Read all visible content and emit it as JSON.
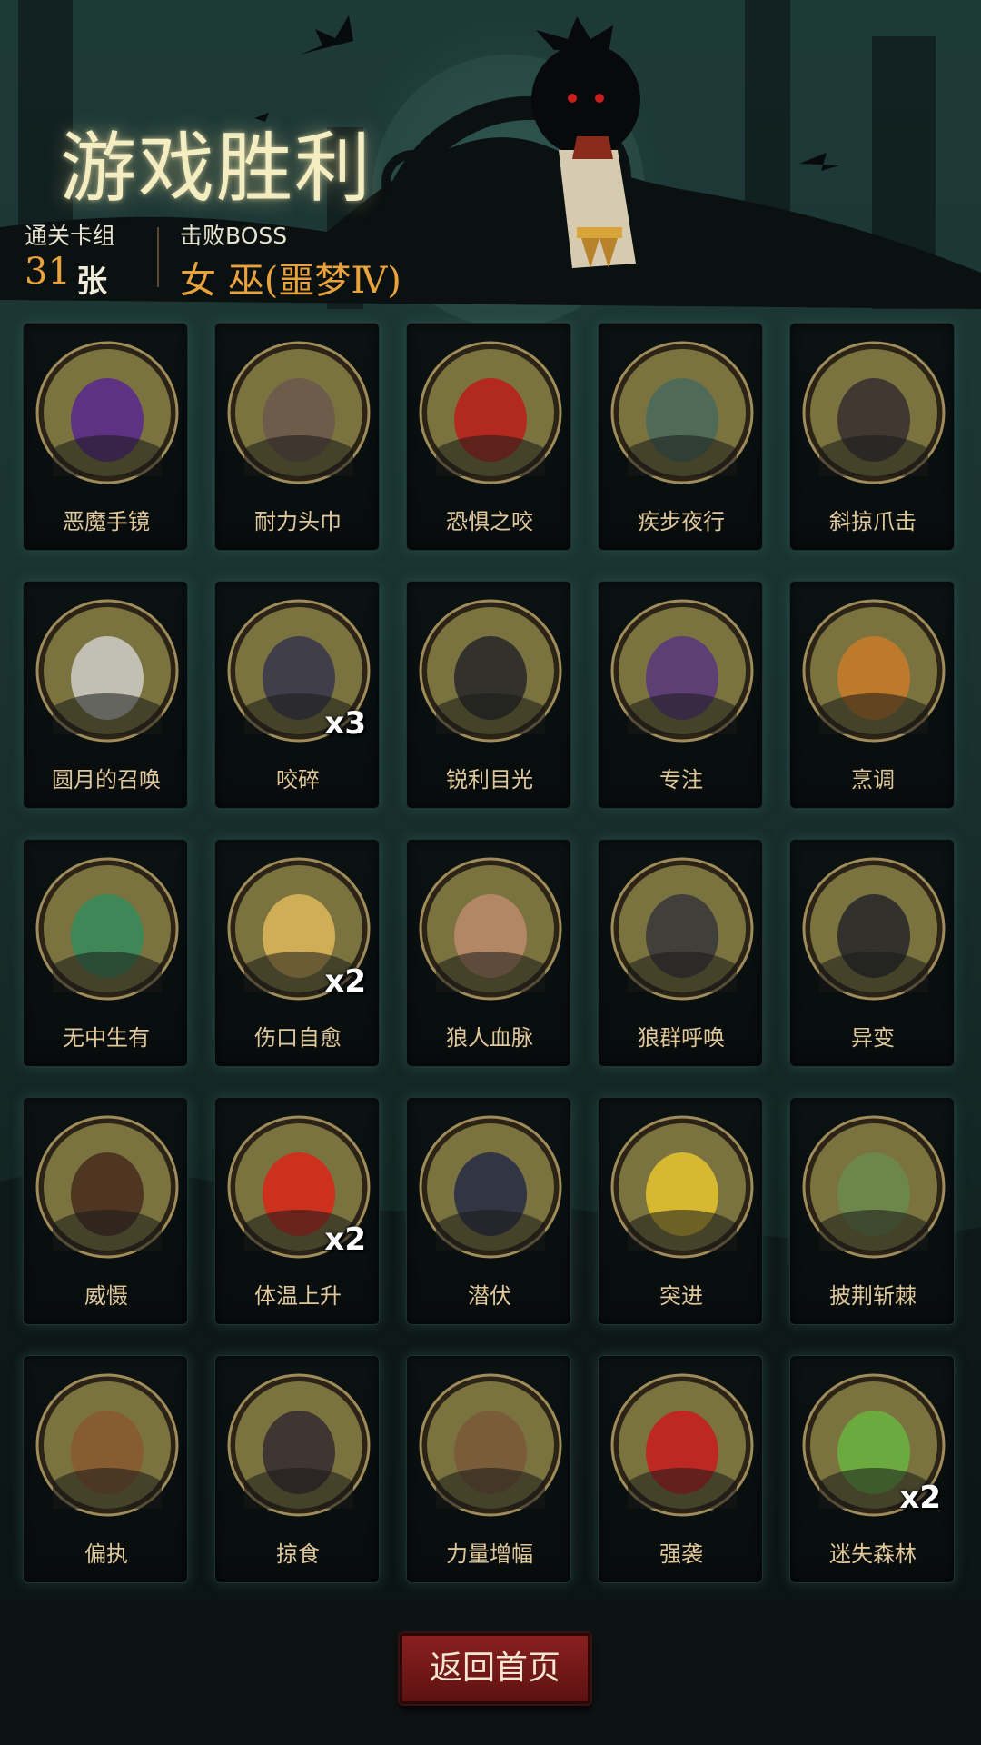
{
  "title": "游戏胜利",
  "stats": {
    "deck_label": "通关卡组",
    "deck_count": "31",
    "deck_unit": "张",
    "boss_label": "击败BOSS",
    "boss_name": "女 巫(噩梦Ⅳ)"
  },
  "cards": [
    {
      "label": "恶魔手镜",
      "icon": "demon-mirror-icon",
      "count": ""
    },
    {
      "label": "耐力头巾",
      "icon": "bandana-icon",
      "count": ""
    },
    {
      "label": "恐惧之咬",
      "icon": "fear-bite-icon",
      "count": ""
    },
    {
      "label": "疾步夜行",
      "icon": "night-stride-icon",
      "count": ""
    },
    {
      "label": "斜掠爪击",
      "icon": "claw-strike-icon",
      "count": ""
    },
    {
      "label": "圆月的召唤",
      "icon": "full-moon-icon",
      "count": ""
    },
    {
      "label": "咬碎",
      "icon": "crush-bite-icon",
      "count": "x3"
    },
    {
      "label": "锐利目光",
      "icon": "sharp-gaze-icon",
      "count": ""
    },
    {
      "label": "专注",
      "icon": "focus-wizard-icon",
      "count": ""
    },
    {
      "label": "烹调",
      "icon": "cooking-fox-icon",
      "count": ""
    },
    {
      "label": "无中生有",
      "icon": "something-from-nothing-icon",
      "count": ""
    },
    {
      "label": "伤口自愈",
      "icon": "wound-heal-icon",
      "count": "x2"
    },
    {
      "label": "狼人血脉",
      "icon": "werewolf-blood-icon",
      "count": ""
    },
    {
      "label": "狼群呼唤",
      "icon": "pack-call-icon",
      "count": ""
    },
    {
      "label": "异变",
      "icon": "mutation-icon",
      "count": ""
    },
    {
      "label": "威慑",
      "icon": "intimidate-icon",
      "count": ""
    },
    {
      "label": "体温上升",
      "icon": "body-heat-icon",
      "count": "x2"
    },
    {
      "label": "潜伏",
      "icon": "lurk-icon",
      "count": ""
    },
    {
      "label": "突进",
      "icon": "charge-icon",
      "count": ""
    },
    {
      "label": "披荆斩棘",
      "icon": "cut-thorns-icon",
      "count": ""
    },
    {
      "label": "偏执",
      "icon": "paranoia-icon",
      "count": ""
    },
    {
      "label": "掠食",
      "icon": "predation-icon",
      "count": ""
    },
    {
      "label": "力量增幅",
      "icon": "strength-boost-icon",
      "count": ""
    },
    {
      "label": "强袭",
      "icon": "assault-icon",
      "count": ""
    },
    {
      "label": "迷失森林",
      "icon": "lost-forest-icon",
      "count": "x2"
    }
  ],
  "footer": {
    "home_button": "返回首页"
  },
  "colors": {
    "accent": "#e9a23c",
    "card_label": "#e0c79a",
    "button": "#7a1b1b",
    "medallion": "#7a733f"
  }
}
